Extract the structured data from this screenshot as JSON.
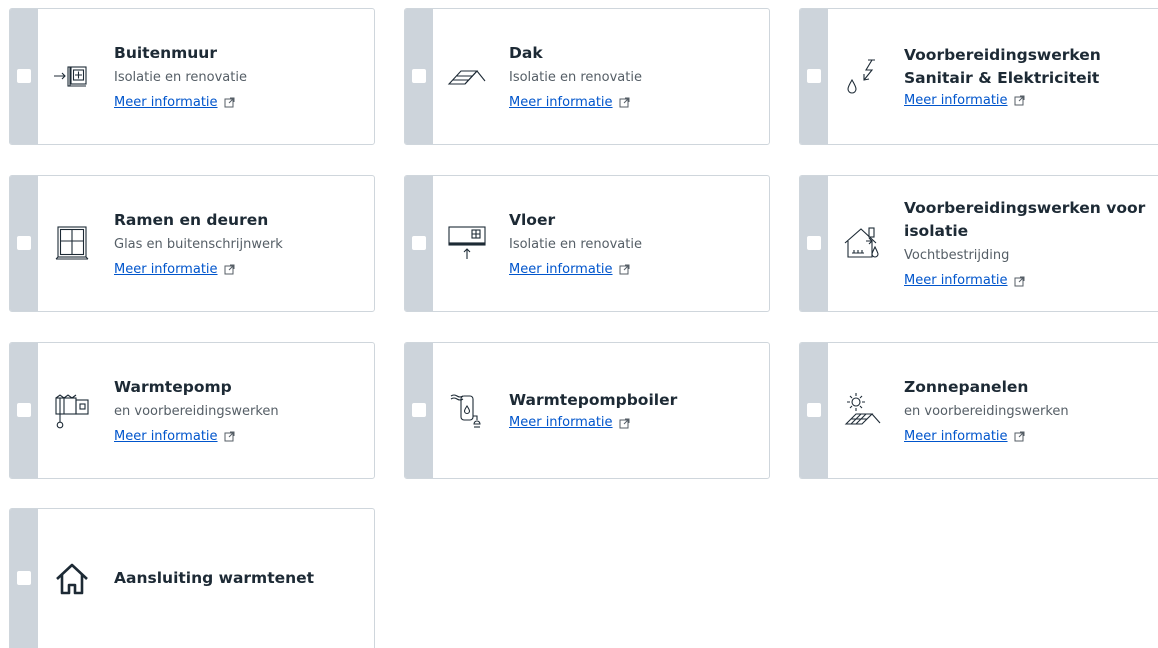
{
  "cards": [
    {
      "title": "Buitenmuur",
      "subtitle": "Isolatie en renovatie",
      "link": "Meer informatie",
      "icon": "wall-insulation-icon"
    },
    {
      "title": "Dak",
      "subtitle": "Isolatie en renovatie",
      "link": "Meer informatie",
      "icon": "roof-icon"
    },
    {
      "title_line1": "Voorbereidingswerken",
      "title_line2": "Sanitair & Elektriciteit",
      "link": "Meer informatie",
      "icon": "lightning-water-icon"
    },
    {
      "title": "Ramen en deuren",
      "subtitle": "Glas en buitenschrijnwerk",
      "link": "Meer informatie",
      "icon": "window-icon"
    },
    {
      "title": "Vloer",
      "subtitle": "Isolatie en renovatie",
      "link": "Meer informatie",
      "icon": "floor-icon"
    },
    {
      "title_line1": "Voorbereidingswerken voor",
      "title_line2": "isolatie",
      "subtitle": "Vochtbestrijding",
      "link": "Meer informatie",
      "icon": "house-moisture-icon"
    },
    {
      "title": "Warmtepomp",
      "subtitle": "en voorbereidingswerken",
      "link": "Meer informatie",
      "icon": "heat-pump-icon"
    },
    {
      "title": "Warmtepompboiler",
      "link": "Meer informatie",
      "icon": "heat-pump-boiler-icon"
    },
    {
      "title": "Zonnepanelen",
      "subtitle": "en voorbereidingswerken",
      "link": "Meer informatie",
      "icon": "solar-panel-icon"
    },
    {
      "title": "Aansluiting warmtenet",
      "icon": "house-icon"
    }
  ],
  "colors": {
    "strip": "#cdd4db",
    "border": "#cfd6dc",
    "title": "#1d2a35",
    "subtitle": "#555e66",
    "link": "#0055cc"
  }
}
